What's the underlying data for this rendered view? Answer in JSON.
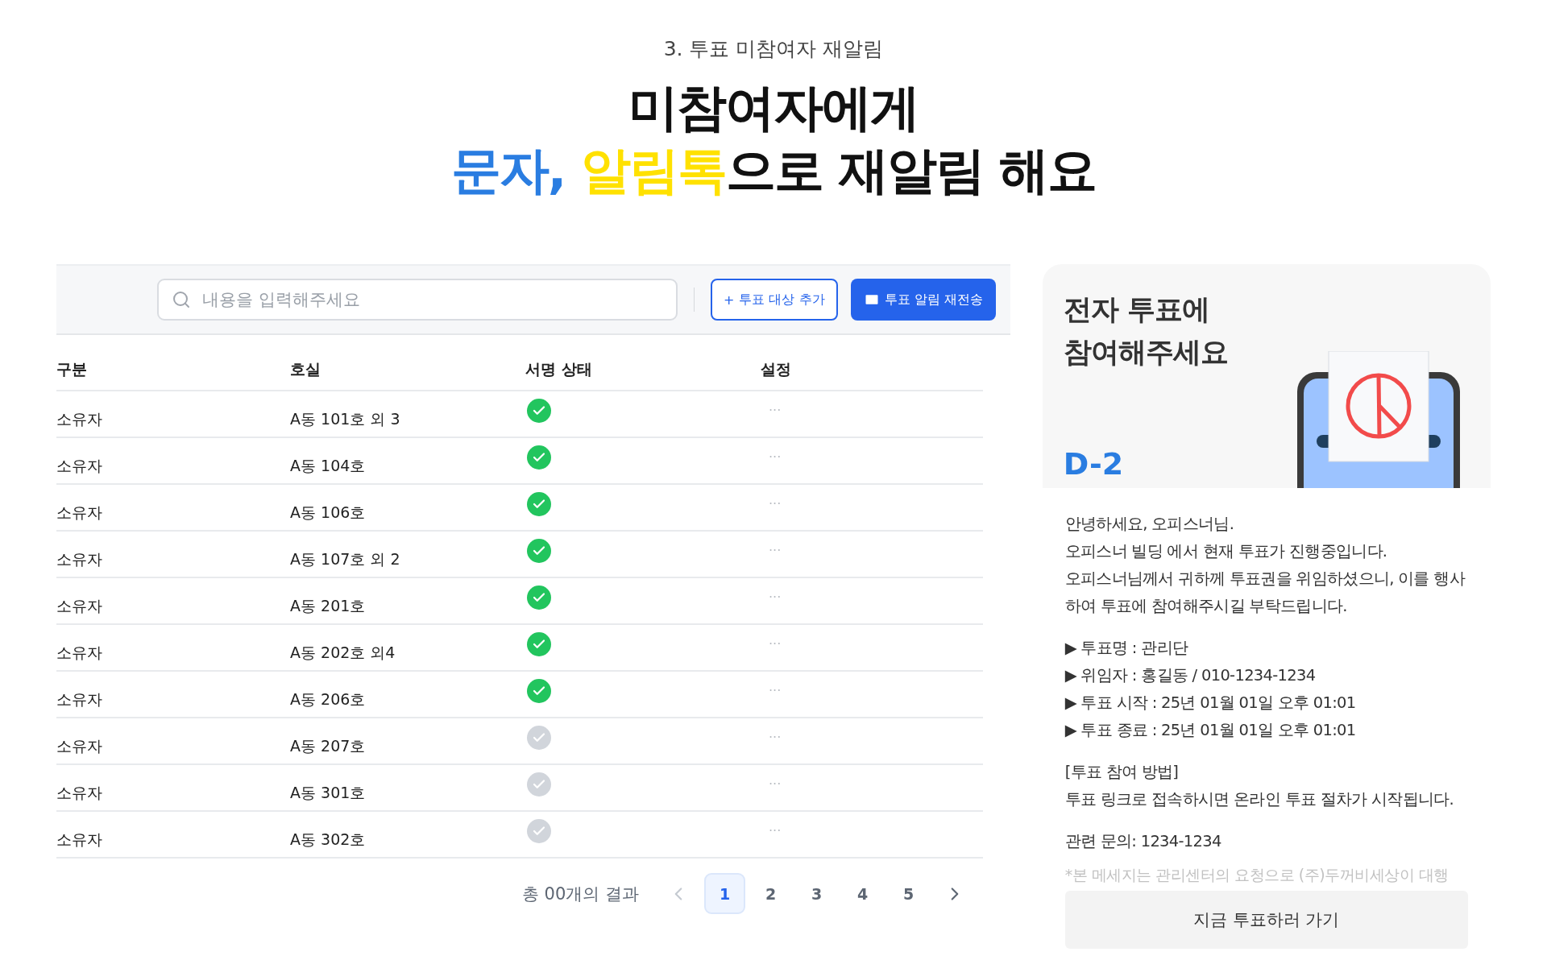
{
  "section_label": "3. 투표 미참여자 재알림",
  "headline": {
    "line_1": "미참여자에게",
    "line_2": [
      {
        "text": "문자, ",
        "color": "#2a7de1"
      },
      {
        "text": "알림톡",
        "color": "#ffe100"
      },
      {
        "text": "으로 재알림 해요",
        "color": "#111111"
      }
    ]
  },
  "toolbar": {
    "search": {
      "placeholder": "내용을 입력해주세요"
    },
    "add_button": {
      "icon": "+",
      "label": "투표 대상 추가"
    },
    "resend_button": "투표 알림 재전송"
  },
  "table": {
    "columns": [
      "구분",
      "호실",
      "서명 상태",
      "설정"
    ],
    "rows": [
      {
        "type": "소유자",
        "unit": "A동 101호 외 3",
        "signed": true,
        "settings": "···"
      },
      {
        "type": "소유자",
        "unit": "A동 104호",
        "signed": true,
        "settings": "···"
      },
      {
        "type": "소유자",
        "unit": "A동 106호",
        "signed": true,
        "settings": "···"
      },
      {
        "type": "소유자",
        "unit": "A동 107호 외 2",
        "signed": true,
        "settings": "···"
      },
      {
        "type": "소유자",
        "unit": "A동 201호",
        "signed": true,
        "settings": "···"
      },
      {
        "type": "소유자",
        "unit": "A동 202호 외4",
        "signed": true,
        "settings": "···"
      },
      {
        "type": "소유자",
        "unit": "A동 206호",
        "signed": true,
        "settings": "···"
      },
      {
        "type": "소유자",
        "unit": "A동 207호",
        "signed": false,
        "settings": "···"
      },
      {
        "type": "소유자",
        "unit": "A동 301호",
        "signed": false,
        "settings": "···"
      },
      {
        "type": "소유자",
        "unit": "A동 302호",
        "signed": false,
        "settings": "···"
      }
    ]
  },
  "pagination": {
    "total": "총 00개의 결과",
    "prev_disabled": true,
    "next_disabled": false,
    "pages": [
      {
        "label": "1",
        "selected": true
      },
      {
        "label": "2",
        "selected": false
      },
      {
        "label": "3",
        "selected": false
      },
      {
        "label": "4",
        "selected": false
      },
      {
        "label": "5",
        "selected": false
      }
    ]
  },
  "message_preview": {
    "title_lines": [
      "전자 투표에",
      "참여해주세요"
    ],
    "dday": "D-2",
    "paragraphs": [
      [
        "안녕하세요, 오피스너님.",
        "오피스너 빌딩 에서 현재 투표가 진행중입니다.",
        "오피스너님께서 귀하께 투표권을 위임하셨으니, 이를 행사하여  투표에 참여해주시길 부탁드립니다."
      ],
      [
        "▶ 투표명 : 관리단",
        "▶ 위임자 : 홍길동 / 010-1234-1234",
        "▶ 투표 시작 : 25년 01월 01일 오후 01:01",
        "▶ 투표 종료 : 25년 01월 01일 오후 01:01"
      ],
      [
        "[투표 참여 방법]",
        "투표 링크로 접속하시면 온라인 투표 절차가 시작됩니다."
      ],
      [
        "관련 문의: 1234-1234"
      ]
    ],
    "footnote": "*본 메세지는 관리센터의 요청으로 (주)두꺼비세상이 대행",
    "cta_button": "지금 투표하러 가기"
  }
}
